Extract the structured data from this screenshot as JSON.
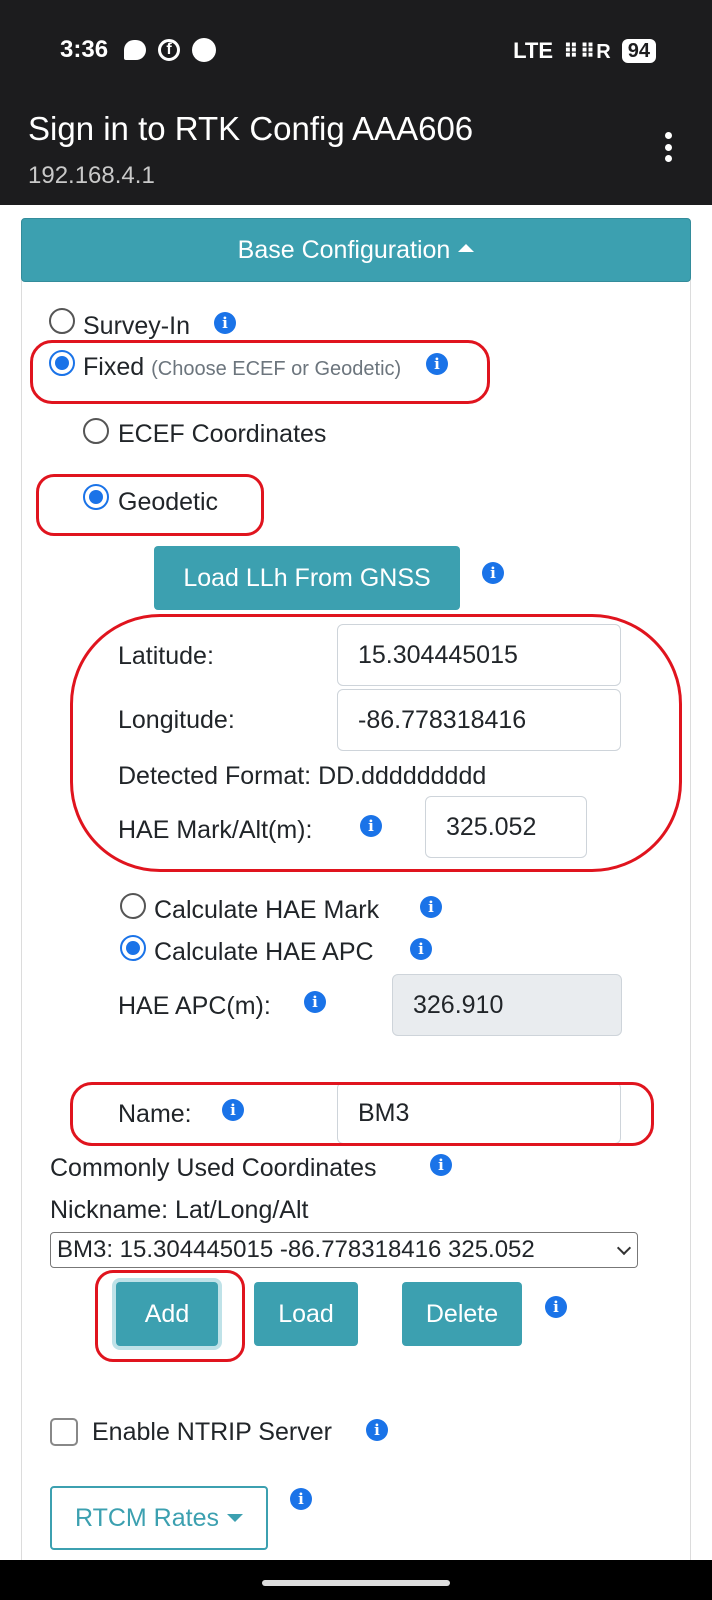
{
  "status_bar": {
    "time": "3:36",
    "network": "LTE",
    "signal": "R",
    "battery": "94"
  },
  "titlebar": {
    "title": "Sign in to RTK Config AAA606",
    "subtitle": "192.168.4.1"
  },
  "base_config": {
    "header_label": "Base Configuration",
    "mode_survey_in": "Survey-In",
    "mode_fixed": "Fixed",
    "mode_fixed_hint": "(Choose ECEF or Geodetic)",
    "coord_ecef": "ECEF Coordinates",
    "coord_geodetic": "Geodetic",
    "load_llh_button": "Load LLh From GNSS",
    "latitude_label": "Latitude:",
    "latitude_value": "15.304445015",
    "longitude_label": "Longitude:",
    "longitude_value": "-86.778318416",
    "detected_format": "Detected Format: DD.ddddddddd",
    "hae_mark_label": "HAE Mark/Alt(m):",
    "hae_mark_value": "325.052",
    "calc_hae_mark": "Calculate HAE Mark",
    "calc_hae_apc": "Calculate HAE APC",
    "hae_apc_label": "HAE APC(m):",
    "hae_apc_value": "326.910",
    "name_label": "Name:",
    "name_value": "BM3",
    "common_coords_label": "Commonly Used Coordinates",
    "nickname_label": "Nickname: Lat/Long/Alt",
    "selected_coordinate": "BM3: 15.304445015 -86.778318416 325.052",
    "add_button": "Add",
    "load_button": "Load",
    "delete_button": "Delete",
    "enable_ntrip_label": "Enable NTRIP Server",
    "rtcm_rates_button": "RTCM Rates"
  },
  "colors": {
    "accent": "#3ca0b0",
    "info": "#1a73e8",
    "annotation": "#e0141e"
  }
}
